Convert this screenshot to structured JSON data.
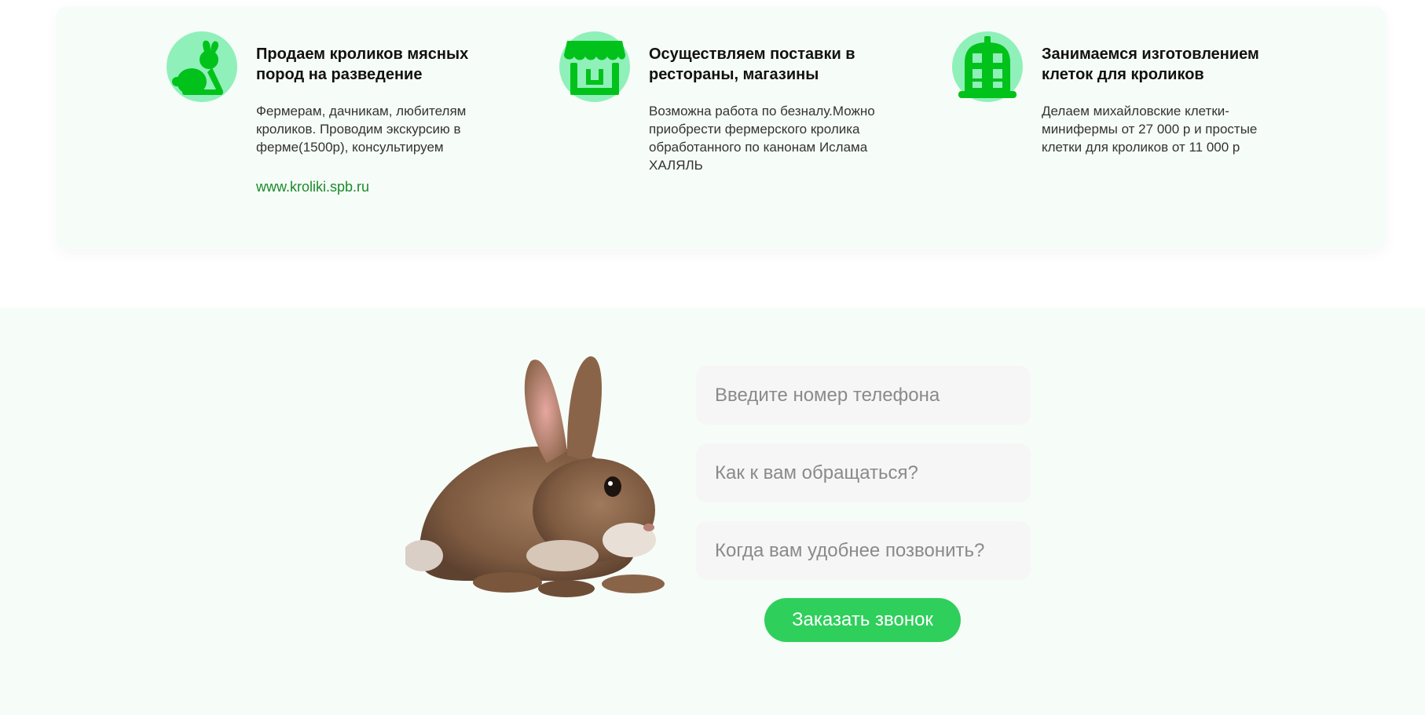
{
  "colors": {
    "accent": "#2fcf5c",
    "icon_green": "#00c21a",
    "icon_bg": "#8ff0b9",
    "link": "#1b8a2a",
    "panel_bg": "#f6fcf8"
  },
  "features": [
    {
      "icon": "rabbit-icon",
      "title": "Продаем кроликов мясных пород на разведение",
      "text": "Фермерам, дачникам, любителям кроликов. Проводим экскурсию в ферме(1500р), консультируем",
      "link": "www.kroliki.spb.ru"
    },
    {
      "icon": "storefront-icon",
      "title": "Осуществляем поставки в рестораны, магазины",
      "text": "Возможна работа по безналу.Можно приобрести фермерского кролика обработанного по канонам Ислама ХАЛЯЛЬ"
    },
    {
      "icon": "rabbit-cage-icon",
      "title": "Занимаемся изготовлением клеток для кроликов",
      "text": "Делаем михайловские клетки-минифермы от 27 000 р и простые клетки для кроликов от 11 000 р"
    }
  ],
  "callback_form": {
    "phone_placeholder": "Введите номер телефона",
    "name_placeholder": "Как к вам обращаться?",
    "time_placeholder": "Когда вам удобнее позвонить?",
    "submit_label": "Заказать звонок"
  }
}
